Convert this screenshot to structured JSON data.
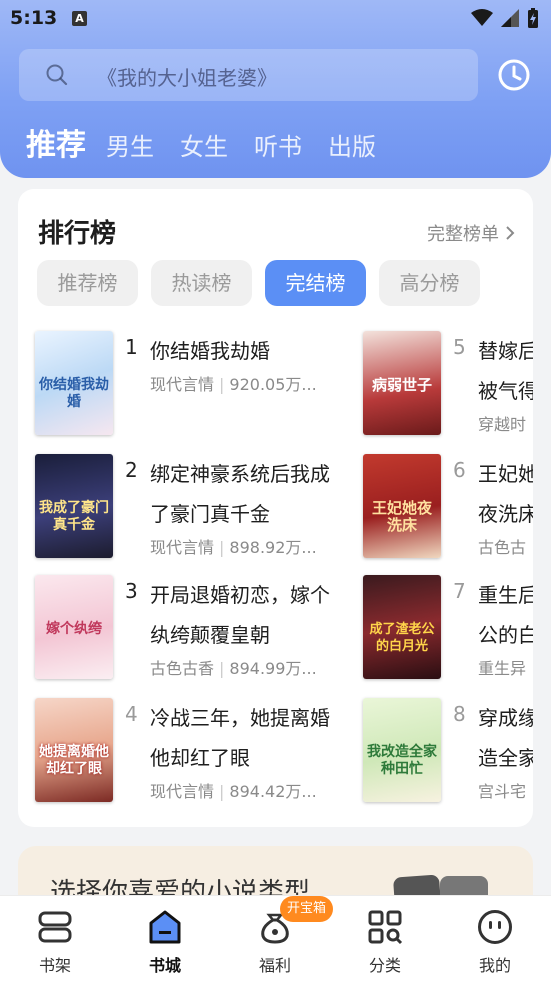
{
  "status": {
    "time": "5:13",
    "a_badge": "A"
  },
  "search": {
    "placeholder": "《我的大小姐老婆》"
  },
  "top_tabs": [
    "推荐",
    "男生",
    "女生",
    "听书",
    "出版"
  ],
  "ranking": {
    "title": "排行榜",
    "more": "完整榜单",
    "tabs": [
      "推荐榜",
      "热读榜",
      "完结榜",
      "高分榜"
    ],
    "active_tab": "完结榜",
    "books": [
      {
        "rank": "1",
        "title": "你结婚我劫婚",
        "genre": "现代言情",
        "count": "920.05万...",
        "cover_text": "你结婚我劫婚"
      },
      {
        "rank": "2",
        "title": "绑定神豪系统后我成了豪门真千金",
        "genre": "现代言情",
        "count": "898.92万...",
        "cover_text": "我成了豪门真千金"
      },
      {
        "rank": "3",
        "title": "开局退婚初恋，嫁个纨绔颠覆皇朝",
        "genre": "古色古香",
        "count": "894.99万...",
        "cover_text": "嫁个纨绔"
      },
      {
        "rank": "4",
        "title": "冷战三年，她提离婚他却红了眼",
        "genre": "现代言情",
        "count": "894.42万...",
        "cover_text": "她提离婚他却红了眼"
      },
      {
        "rank": "5",
        "title": "替嫁后被气得",
        "genre": "穿越时",
        "count": "",
        "cover_text": "病弱世子"
      },
      {
        "rank": "6",
        "title": "王妃她夜洗床",
        "genre": "古色古",
        "count": "",
        "cover_text": "王妃她夜洗床"
      },
      {
        "rank": "7",
        "title": "重生后公的白",
        "genre": "重生异",
        "count": "",
        "cover_text": "成了渣老公的白月光"
      },
      {
        "rank": "8",
        "title": "穿成缘造全家",
        "genre": "宫斗宅",
        "count": "",
        "cover_text": "我改造全家种田忙"
      }
    ]
  },
  "promo": {
    "text": "选择你喜爱的小说类型"
  },
  "bottom_nav": {
    "items": [
      "书架",
      "书城",
      "福利",
      "分类",
      "我的"
    ],
    "badge": "开宝箱"
  },
  "colors": {
    "accent": "#5b8ff5",
    "header": "#7fa1f4",
    "badge": "#ff8a1f"
  }
}
